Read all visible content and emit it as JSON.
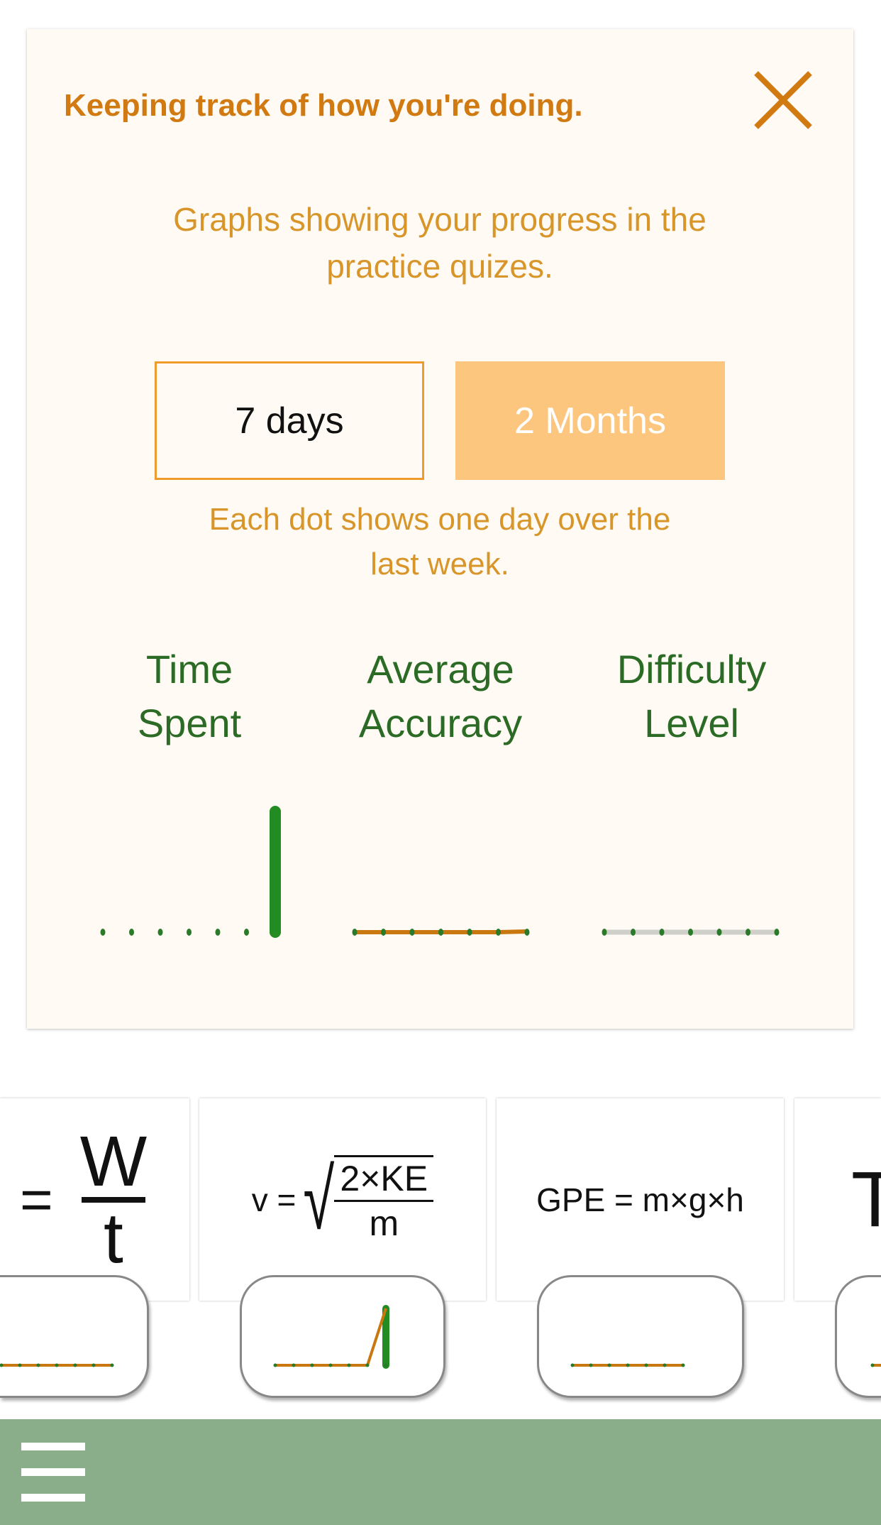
{
  "card": {
    "title": "Keeping track of how you're doing.",
    "close_icon": "close-x-icon",
    "subtitle_line1": "Graphs showing your progress in the",
    "subtitle_line2": "practice quizes.",
    "range_buttons": [
      {
        "label": "7 days",
        "selected": false
      },
      {
        "label": "2 Months",
        "selected": true
      }
    ],
    "caption_line1": "Each dot shows one day over the",
    "caption_line2": "last week.",
    "columns": [
      {
        "line1": "Time",
        "line2": "Spent"
      },
      {
        "line1": "Average",
        "line2": "Accuracy"
      },
      {
        "line1": "Difficulty",
        "line2": "Level"
      }
    ]
  },
  "chart_data": [
    {
      "type": "bar",
      "name_printed": "Time Spent",
      "values": [
        0,
        0,
        0,
        0,
        0,
        0,
        1
      ]
    },
    {
      "type": "line",
      "name_printed": "Average Accuracy",
      "values": [
        0,
        0,
        0,
        0,
        0,
        0,
        0.1
      ]
    },
    {
      "type": "line",
      "name_printed": "Difficulty Level",
      "values": [
        0,
        0,
        0,
        0,
        0,
        0,
        0
      ]
    }
  ],
  "formulas": [
    {
      "lhs": "=",
      "numerator": "W",
      "denominator": "t"
    },
    {
      "lhs": "v =",
      "numerator": "2×KE",
      "denominator": "m"
    },
    {
      "text": "GPE = m×g×h"
    },
    {
      "text": "T"
    }
  ],
  "mini_charts": [
    {
      "values": [
        0,
        0,
        0,
        0,
        0,
        0,
        0
      ]
    },
    {
      "values": [
        0,
        0,
        0,
        0,
        0,
        0,
        1
      ]
    },
    {
      "values": [
        0,
        0,
        0,
        0,
        0,
        0,
        0
      ]
    },
    {
      "values": [
        0,
        0,
        0,
        0,
        0,
        0,
        0
      ]
    }
  ],
  "colors": {
    "accent": "#d17a12",
    "selected_button": "#fcc67e",
    "green": "#228b22",
    "bottom_bar": "#8aae8a"
  },
  "menu_icon": "hamburger-menu-icon"
}
